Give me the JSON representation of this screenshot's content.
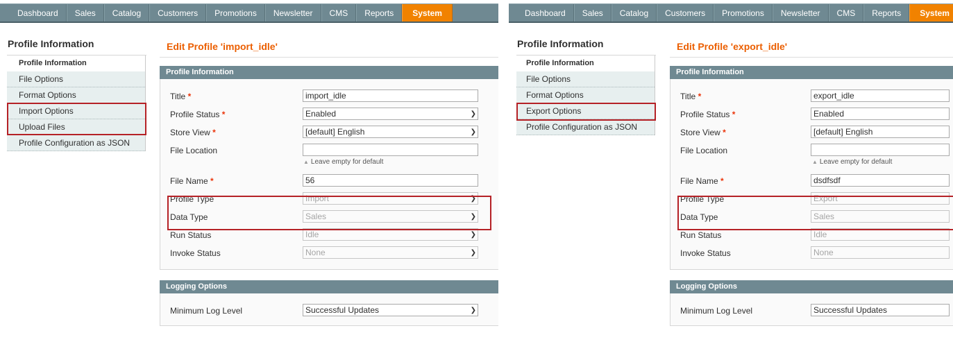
{
  "left": {
    "nav": [
      "Dashboard",
      "Sales",
      "Catalog",
      "Customers",
      "Promotions",
      "Newsletter",
      "CMS",
      "Reports",
      "System"
    ],
    "sidebar_title": "Profile Information",
    "tabs": [
      "Profile Information",
      "File Options",
      "Format Options",
      "Import Options",
      "Upload Files",
      "Profile Configuration as JSON"
    ],
    "page_title": "Edit Profile 'import_idle'",
    "section_profile": "Profile Information",
    "fields": {
      "title_label": "Title",
      "title_value": "import_idle",
      "status_label": "Profile Status",
      "status_value": "Enabled",
      "store_label": "Store View",
      "store_value": "[default] English",
      "location_label": "File Location",
      "location_value": "",
      "location_hint": "Leave empty for default",
      "filename_label": "File Name",
      "filename_value": "56",
      "ptype_label": "Profile Type",
      "ptype_value": "Import",
      "dtype_label": "Data Type",
      "dtype_value": "Sales",
      "run_label": "Run Status",
      "run_value": "Idle",
      "invoke_label": "Invoke Status",
      "invoke_value": "None"
    },
    "section_logging": "Logging Options",
    "log_label": "Minimum Log Level",
    "log_value": "Successful Updates"
  },
  "right": {
    "nav": [
      "Dashboard",
      "Sales",
      "Catalog",
      "Customers",
      "Promotions",
      "Newsletter",
      "CMS",
      "Reports",
      "System"
    ],
    "sidebar_title": "Profile Information",
    "tabs": [
      "Profile Information",
      "File Options",
      "Format Options",
      "Export Options",
      "Profile Configuration as JSON"
    ],
    "page_title": "Edit Profile 'export_idle'",
    "section_profile": "Profile Information",
    "fields": {
      "title_label": "Title",
      "title_value": "export_idle",
      "status_label": "Profile Status",
      "status_value": "Enabled",
      "store_label": "Store View",
      "store_value": "[default] English",
      "location_label": "File Location",
      "location_value": "",
      "location_hint": "Leave empty for default",
      "filename_label": "File Name",
      "filename_value": "dsdfsdf",
      "ptype_label": "Profile Type",
      "ptype_value": "Export",
      "dtype_label": "Data Type",
      "dtype_value": "Sales",
      "run_label": "Run Status",
      "run_value": "Idle",
      "invoke_label": "Invoke Status",
      "invoke_value": "None"
    },
    "section_logging": "Logging Options",
    "log_label": "Minimum Log Level",
    "log_value": "Successful Updates"
  },
  "required_marker": "*",
  "colors": {
    "nav_bg": "#6f8992",
    "nav_active": "#f18200",
    "title_orange": "#eb5e00",
    "highlight_red": "#b52126",
    "tab_bg": "#e7efef"
  }
}
